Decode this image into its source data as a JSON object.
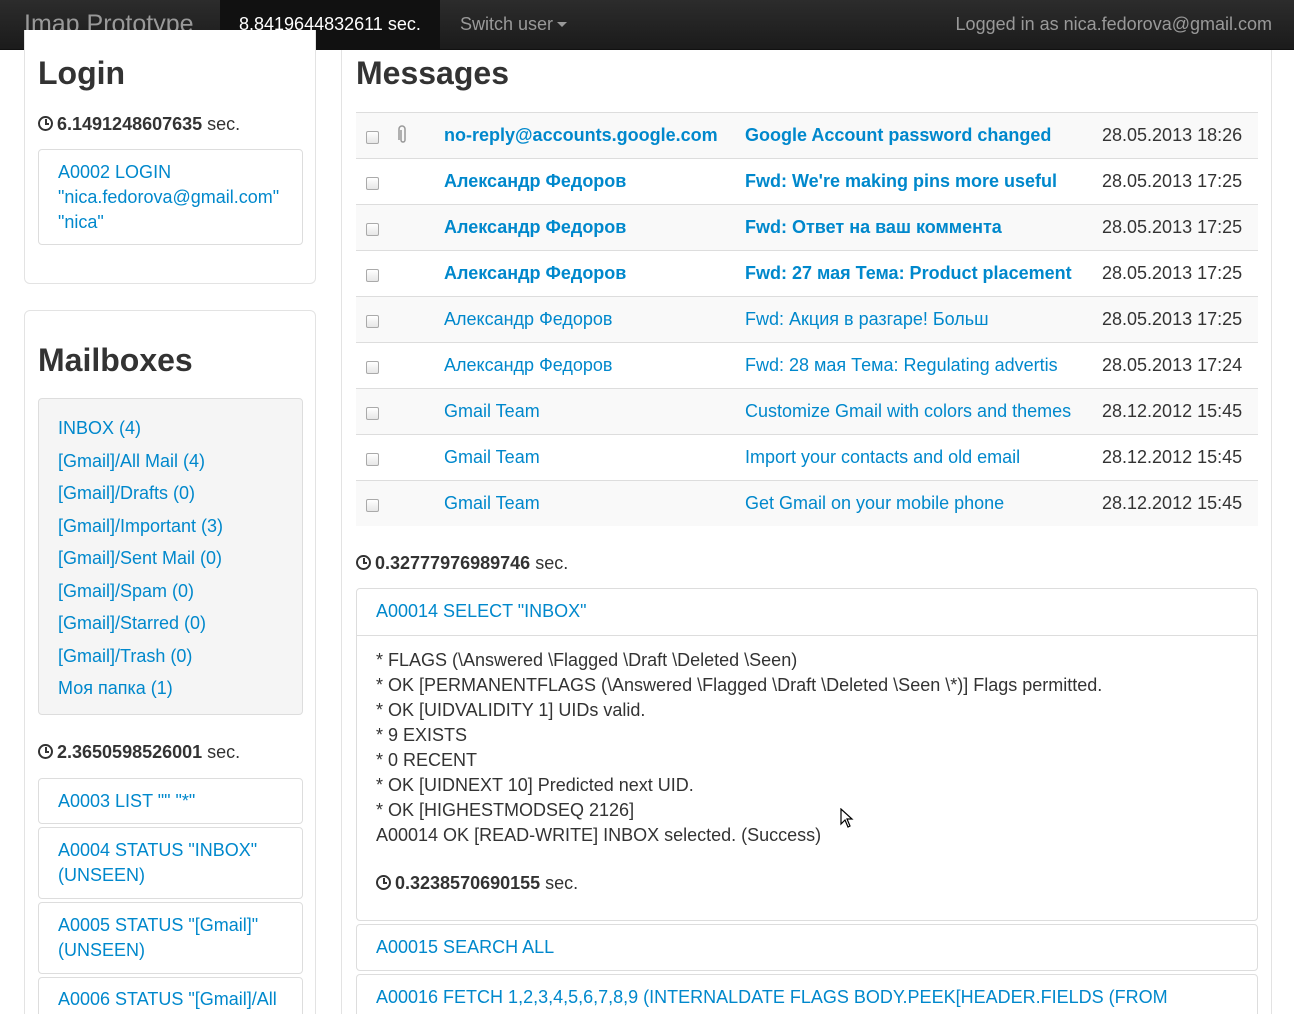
{
  "navbar": {
    "brand": "Imap Prototype",
    "timer": "8.8419644832611 sec.",
    "switch_user": "Switch user",
    "logged_in": "Logged in as nica.fedorova@gmail.com"
  },
  "login": {
    "title": "Login",
    "time_value": "6.1491248607635",
    "time_unit": "sec.",
    "command_lines": [
      "A0002 LOGIN",
      "\"nica.fedorova@gmail.com\"",
      "\"nica\""
    ]
  },
  "mailboxes": {
    "title": "Mailboxes",
    "items": [
      "INBOX (4)",
      "[Gmail]/All Mail (4)",
      "[Gmail]/Drafts (0)",
      "[Gmail]/Important (3)",
      "[Gmail]/Sent Mail (0)",
      "[Gmail]/Spam (0)",
      "[Gmail]/Starred (0)",
      "[Gmail]/Trash (0)",
      "Моя папка (1)"
    ],
    "time_value": "2.3650598526001",
    "time_unit": "sec.",
    "commands": [
      {
        "lines": [
          "A0003 LIST \"\" \"*\""
        ]
      },
      {
        "lines": [
          "A0004 STATUS \"INBOX\"",
          "(UNSEEN)"
        ]
      },
      {
        "lines": [
          "A0005 STATUS \"[Gmail]\"",
          "(UNSEEN)"
        ]
      },
      {
        "lines": [
          "A0006 STATUS \"[Gmail]/All"
        ]
      }
    ]
  },
  "messages": {
    "title": "Messages",
    "rows": [
      {
        "from": "no-reply@accounts.google.com",
        "subject": "Google Account password changed",
        "date": "28.05.2013 18:26"
      },
      {
        "from": "Александр Федоров",
        "subject": "Fwd: We're making pins more useful",
        "date": "28.05.2013 17:25"
      },
      {
        "from": "Александр Федоров",
        "subject": "Fwd: Ответ на ваш коммента",
        "date": "28.05.2013 17:25"
      },
      {
        "from": "Александр Федоров",
        "subject": "Fwd: 27 мая Тема: Product placement",
        "date": "28.05.2013 17:25"
      },
      {
        "from": "Александр Федоров",
        "subject": "Fwd: Акция в разгаре! Больш",
        "date": "28.05.2013 17:25"
      },
      {
        "from": "Александр Федоров",
        "subject": "Fwd: 28 мая Тема: Regulating advertis",
        "date": "28.05.2013 17:24"
      },
      {
        "from": "Gmail Team",
        "subject": "Customize Gmail with colors and themes",
        "date": "28.12.2012 15:45"
      },
      {
        "from": "Gmail Team",
        "subject": "Import your contacts and old email",
        "date": "28.12.2012 15:45"
      },
      {
        "from": "Gmail Team",
        "subject": "Get Gmail on your mobile phone",
        "date": "28.12.2012 15:45"
      }
    ],
    "time_value": "0.32777976989746",
    "time_unit": "sec."
  },
  "log": {
    "select_command": "A00014 SELECT \"INBOX\"",
    "select_response": [
      "* FLAGS (\\Answered \\Flagged \\Draft \\Deleted \\Seen)",
      "* OK [PERMANENTFLAGS (\\Answered \\Flagged \\Draft \\Deleted \\Seen \\*)] Flags permitted.",
      "* OK [UIDVALIDITY 1] UIDs valid.",
      "* 9 EXISTS",
      "* 0 RECENT",
      "* OK [UIDNEXT 10] Predicted next UID.",
      "* OK [HIGHESTMODSEQ 2126]",
      "A00014 OK [READ-WRITE] INBOX selected. (Success)"
    ],
    "select_time_value": "0.3238570690155",
    "select_time_unit": "sec.",
    "search_command": "A00015 SEARCH ALL",
    "fetch_command": "A00016 FETCH 1,2,3,4,5,6,7,8,9 (INTERNALDATE FLAGS BODY.PEEK[HEADER.FIELDS (FROM"
  }
}
